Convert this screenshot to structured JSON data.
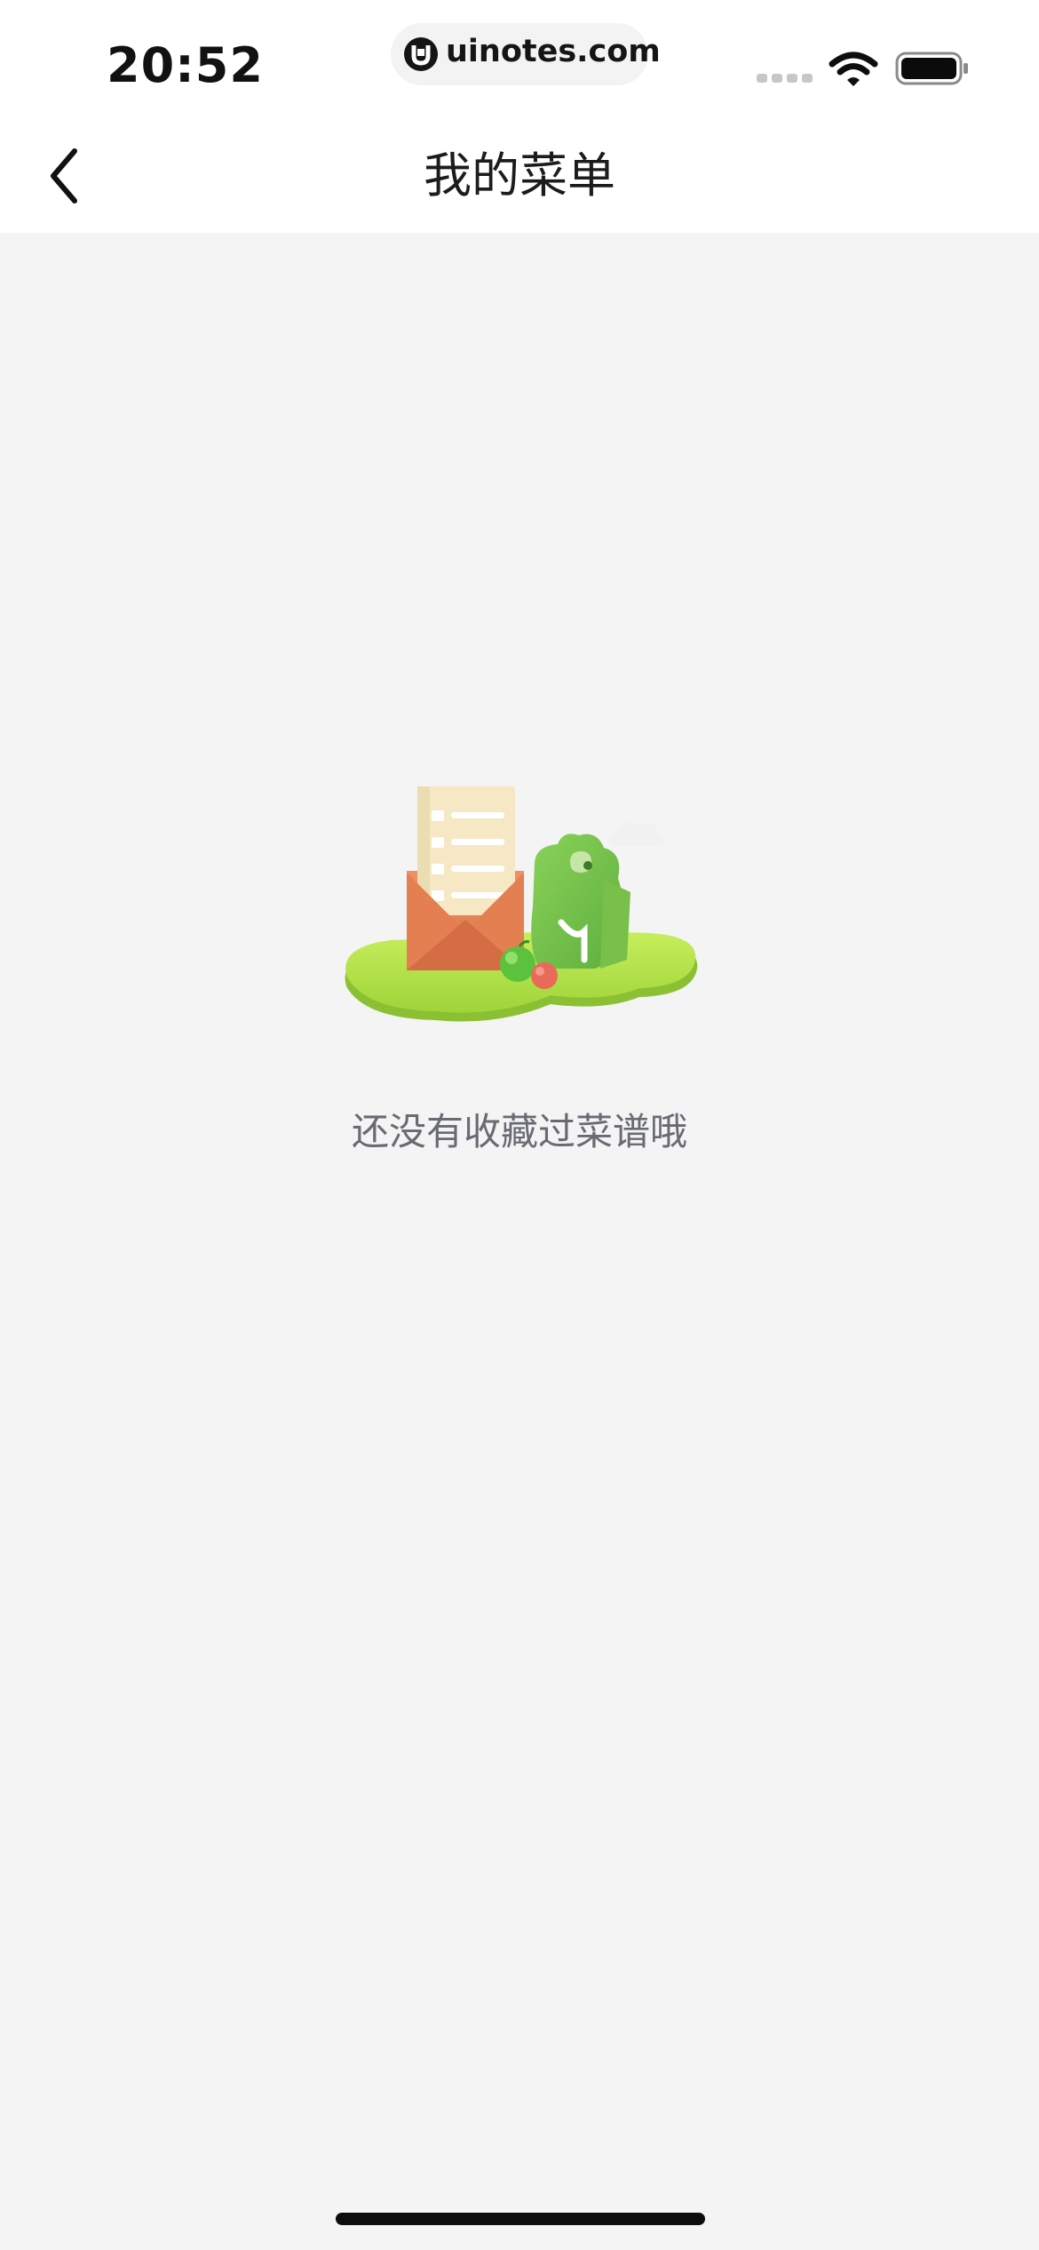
{
  "status_bar": {
    "time": "20:52",
    "url": "uinotes.com"
  },
  "nav": {
    "title": "我的菜单",
    "back_icon": "chevron-left-icon"
  },
  "empty_state": {
    "message": "还没有收藏过菜谱哦",
    "illustration": "envelope-recipe-illustration"
  },
  "colors": {
    "page_background": "#f4f4f4",
    "header_background": "#ffffff",
    "title_text": "#1c1c1c",
    "empty_text": "#686b72",
    "accent_green": "#9ed73a",
    "envelope_orange": "#e8845a"
  }
}
